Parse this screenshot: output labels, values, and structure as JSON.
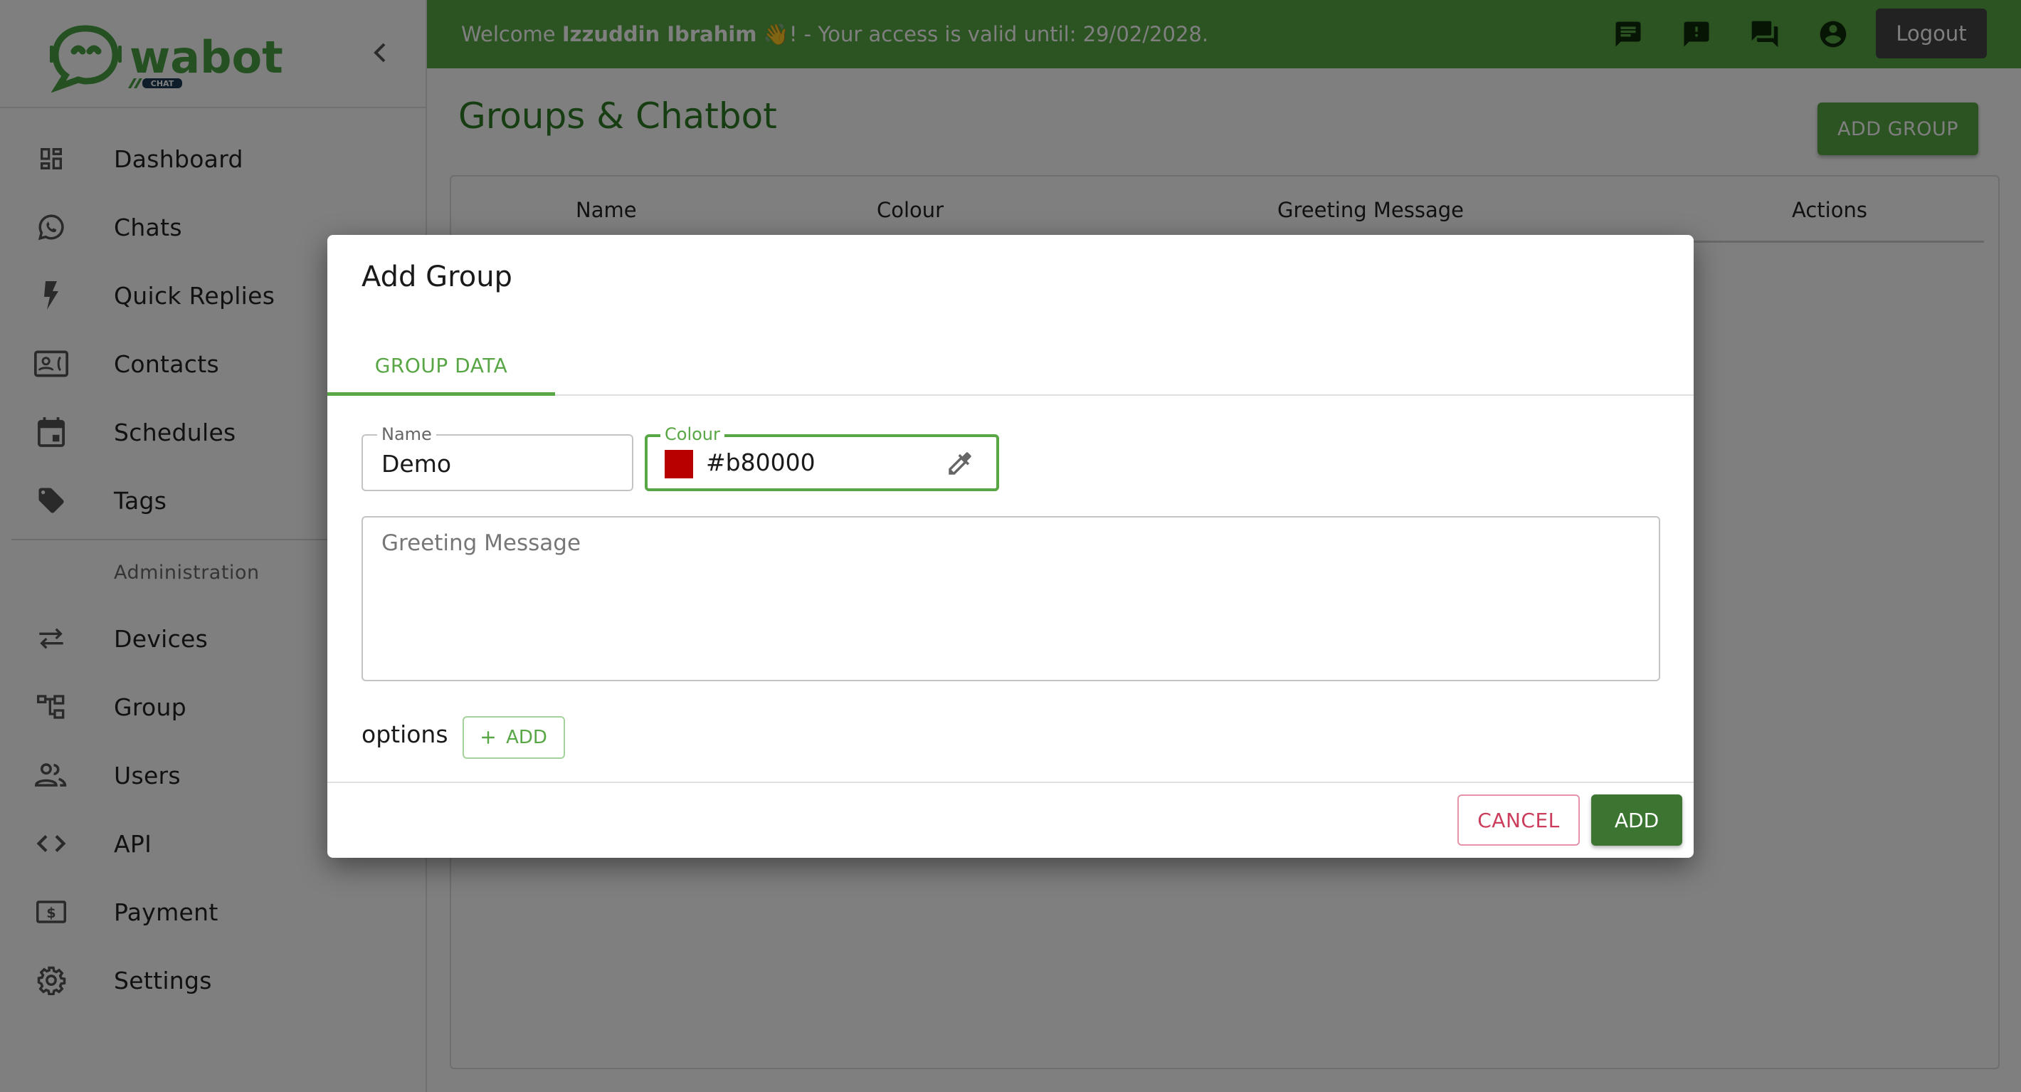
{
  "brand": {
    "name": "wabot",
    "tag": "CHAT"
  },
  "sidebar": {
    "items": [
      {
        "label": "Dashboard",
        "icon": "dashboard-icon"
      },
      {
        "label": "Chats",
        "icon": "whatsapp-icon"
      },
      {
        "label": "Quick Replies",
        "icon": "bolt-icon"
      },
      {
        "label": "Contacts",
        "icon": "contact-card-icon"
      },
      {
        "label": "Schedules",
        "icon": "calendar-icon"
      },
      {
        "label": "Tags",
        "icon": "tag-icon"
      }
    ],
    "section_title": "Administration",
    "admin_items": [
      {
        "label": "Devices",
        "icon": "swap-arrows-icon"
      },
      {
        "label": "Group",
        "icon": "account-tree-icon"
      },
      {
        "label": "Users",
        "icon": "people-icon"
      },
      {
        "label": "API",
        "icon": "code-icon"
      },
      {
        "label": "Payment",
        "icon": "money-icon"
      },
      {
        "label": "Settings",
        "icon": "gear-icon"
      }
    ]
  },
  "topbar": {
    "welcome_prefix": "Welcome ",
    "user_name": "Izzuddin Ibrahim",
    "wave": "👋",
    "welcome_suffix": "! - Your access is valid until: 29/02/2028.",
    "icons": [
      "chat-icon",
      "feedback-icon",
      "forum-icon",
      "account-circle-icon"
    ],
    "logout_label": "Logout"
  },
  "page": {
    "title": "Groups & Chatbot",
    "add_group_label": "ADD GROUP",
    "table_headers": [
      "Name",
      "Colour",
      "Greeting Message",
      "Actions"
    ]
  },
  "modal": {
    "title": "Add Group",
    "tab_label": "GROUP DATA",
    "name_label": "Name",
    "name_value": "Demo",
    "colour_label": "Colour",
    "colour_value": "#b80000",
    "greeting_placeholder": "Greeting Message",
    "greeting_value": "",
    "options_label": "options",
    "options_add_label": "ADD",
    "cancel_label": "CANCEL",
    "add_label": "ADD"
  },
  "colors": {
    "brand_green": "#58a645",
    "dark_green": "#3b7531",
    "cancel_red": "#cc3c5c",
    "selected_colour": "#b80000"
  }
}
